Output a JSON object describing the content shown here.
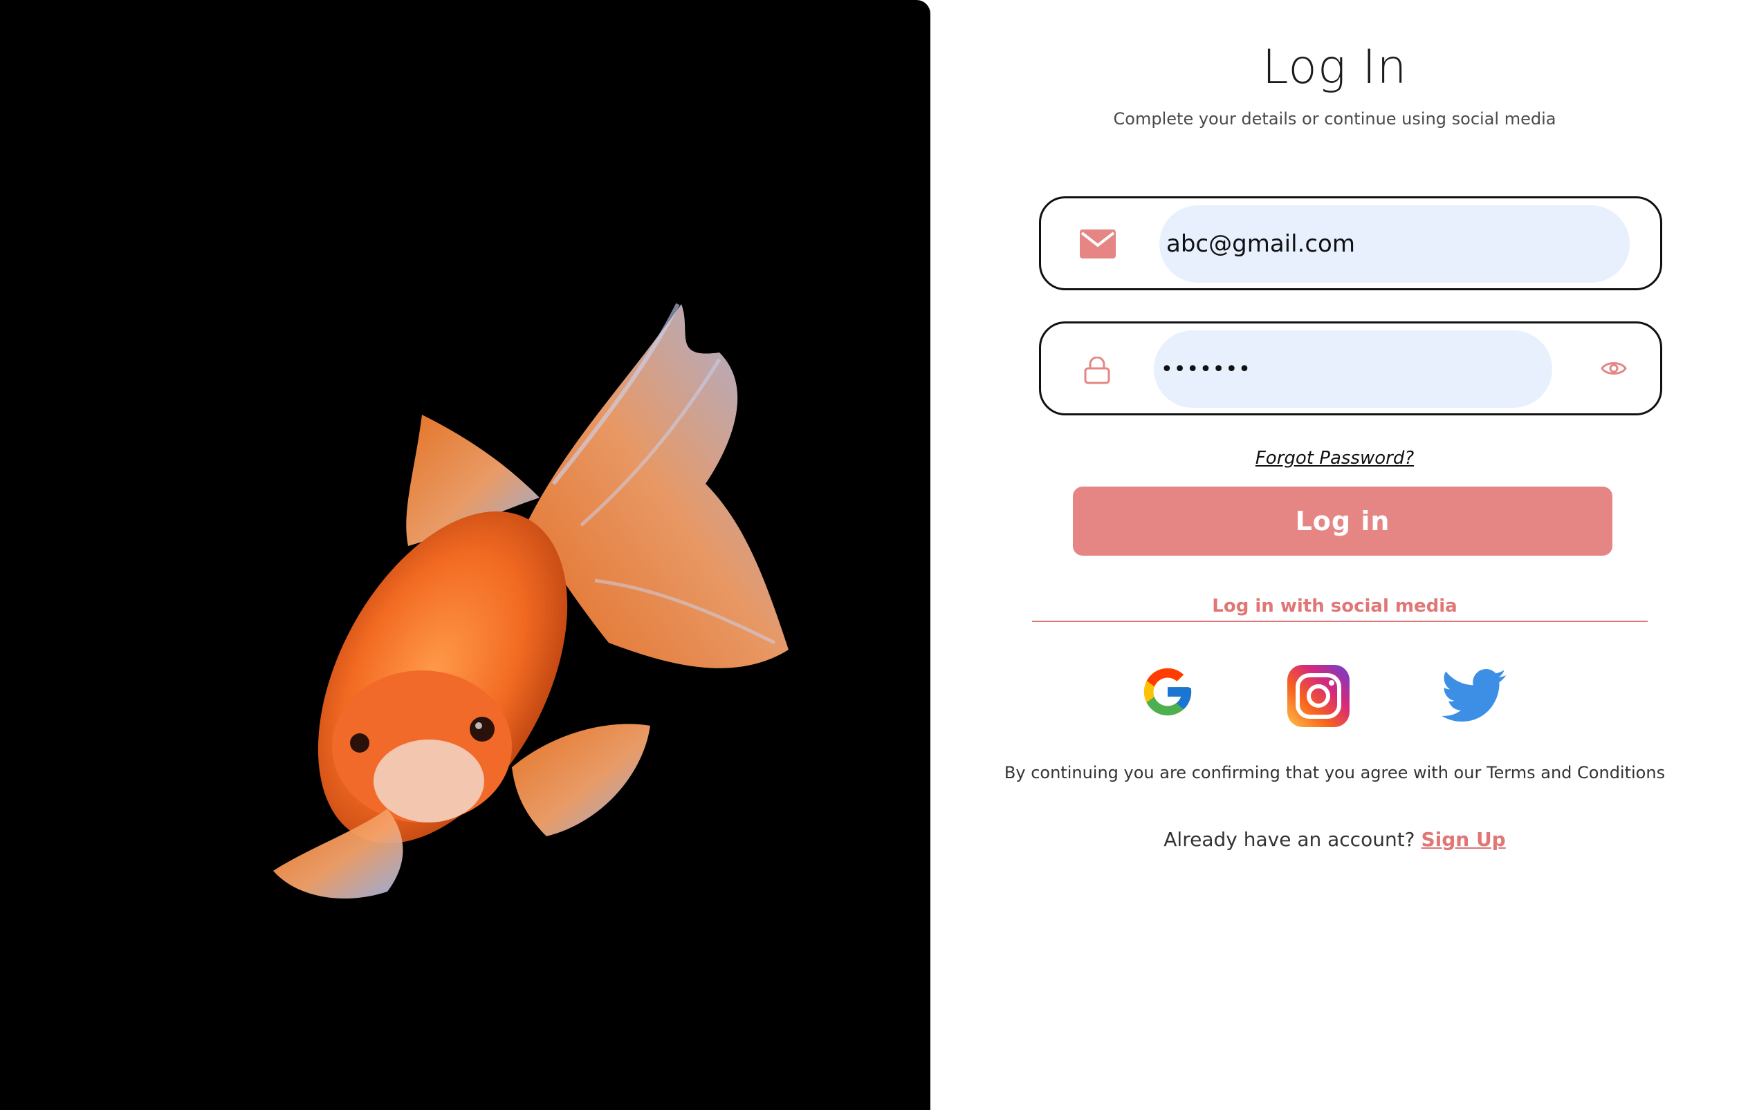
{
  "hero": {
    "image": "goldfish-photo"
  },
  "header": {
    "title": "Log In",
    "subtitle": "Complete your details or continue using social media"
  },
  "form": {
    "email_value": "abc@gmail.com",
    "password_value": "•••••••",
    "forgot_label": "Forgot Password?",
    "login_label": "Log in"
  },
  "social": {
    "label": "Log in with social media",
    "icons": [
      "google-icon",
      "instagram-icon",
      "twitter-icon"
    ]
  },
  "footer": {
    "terms": "By continuing you are confirming that you agree with our Terms and Conditions",
    "signup_prompt": "Already have an account?",
    "signup_link": "Sign Up"
  },
  "colors": {
    "accent": "#e58685",
    "accent_text": "#e07675",
    "input_fill": "#e8f0fe",
    "hero_bg": "#000000"
  }
}
